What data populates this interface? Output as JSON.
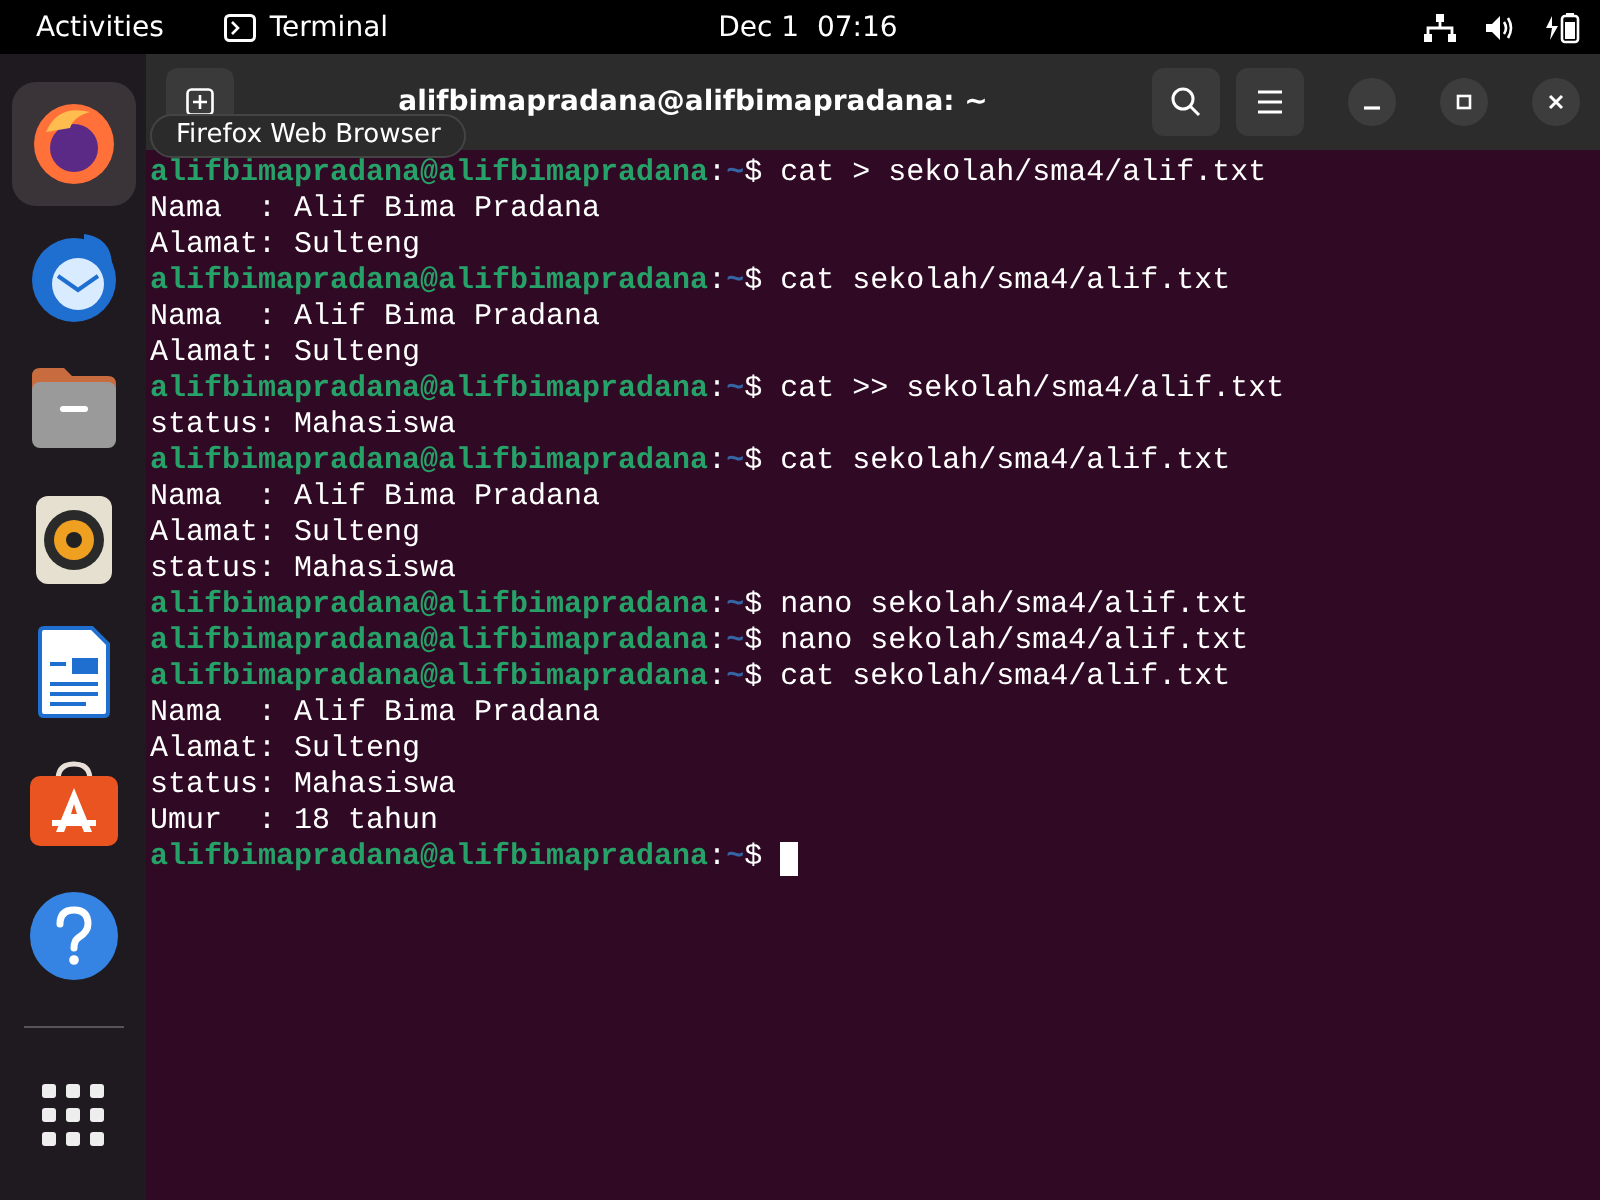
{
  "top_bar": {
    "activities": "Activities",
    "app": "Terminal",
    "clock": "Dec 1  07:16"
  },
  "dock": {
    "items": [
      {
        "kind": "browser",
        "selected": true
      },
      {
        "kind": "mail",
        "selected": false
      },
      {
        "kind": "files",
        "selected": false
      },
      {
        "kind": "music",
        "selected": false
      },
      {
        "kind": "writer",
        "selected": false
      },
      {
        "kind": "store",
        "selected": false
      },
      {
        "kind": "help",
        "selected": false
      }
    ],
    "tooltip": "Firefox Web Browser"
  },
  "window": {
    "title": "alifbimapradana@alifbimapradana: ~"
  },
  "terminal": {
    "lines": [
      {
        "kind": "prompt",
        "user": "alifbimapradana@alifbimapradana",
        "sep": ":",
        "path": "~",
        "sigil": "$",
        "command": "cat > sekolah/sma4/alif.txt"
      },
      {
        "kind": "output",
        "text": "Nama  : Alif Bima Pradana"
      },
      {
        "kind": "output",
        "text": "Alamat: Sulteng"
      },
      {
        "kind": "prompt",
        "user": "alifbimapradana@alifbimapradana",
        "sep": ":",
        "path": "~",
        "sigil": "$",
        "command": "cat sekolah/sma4/alif.txt"
      },
      {
        "kind": "output",
        "text": "Nama  : Alif Bima Pradana"
      },
      {
        "kind": "output",
        "text": "Alamat: Sulteng"
      },
      {
        "kind": "prompt",
        "user": "alifbimapradana@alifbimapradana",
        "sep": ":",
        "path": "~",
        "sigil": "$",
        "command": "cat >> sekolah/sma4/alif.txt"
      },
      {
        "kind": "output",
        "text": "status: Mahasiswa"
      },
      {
        "kind": "prompt",
        "user": "alifbimapradana@alifbimapradana",
        "sep": ":",
        "path": "~",
        "sigil": "$",
        "command": "cat sekolah/sma4/alif.txt"
      },
      {
        "kind": "output",
        "text": "Nama  : Alif Bima Pradana"
      },
      {
        "kind": "output",
        "text": "Alamat: Sulteng"
      },
      {
        "kind": "output",
        "text": "status: Mahasiswa"
      },
      {
        "kind": "prompt",
        "user": "alifbimapradana@alifbimapradana",
        "sep": ":",
        "path": "~",
        "sigil": "$",
        "command": "nano sekolah/sma4/alif.txt"
      },
      {
        "kind": "prompt",
        "user": "alifbimapradana@alifbimapradana",
        "sep": ":",
        "path": "~",
        "sigil": "$",
        "command": "nano sekolah/sma4/alif.txt"
      },
      {
        "kind": "prompt",
        "user": "alifbimapradana@alifbimapradana",
        "sep": ":",
        "path": "~",
        "sigil": "$",
        "command": "cat sekolah/sma4/alif.txt"
      },
      {
        "kind": "output",
        "text": "Nama  : Alif Bima Pradana"
      },
      {
        "kind": "output",
        "text": "Alamat: Sulteng"
      },
      {
        "kind": "output",
        "text": "status: Mahasiswa"
      },
      {
        "kind": "output",
        "text": "Umur  : 18 tahun"
      },
      {
        "kind": "prompt",
        "user": "alifbimapradana@alifbimapradana",
        "sep": ":",
        "path": "~",
        "sigil": "$",
        "cursor": true
      }
    ]
  }
}
